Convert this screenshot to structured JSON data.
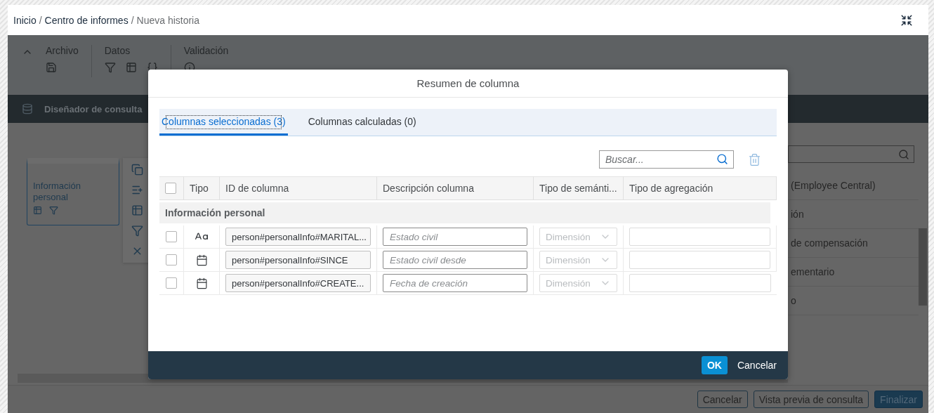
{
  "header": {
    "breadcrumb": [
      {
        "label": "Inicio",
        "current": false
      },
      {
        "separator": "/",
        "label": "Centro de informes",
        "current": false
      },
      {
        "separator": "/",
        "label": "Nueva historia",
        "current": true
      }
    ]
  },
  "toolbar": {
    "groups": [
      {
        "label": "Archivo",
        "kind": "file"
      },
      {
        "label": "Datos",
        "kind": "data"
      },
      {
        "label": "Validación",
        "kind": "validation"
      }
    ]
  },
  "designer_bar": {
    "title": "Diseñador de consulta"
  },
  "canvas": {
    "node": {
      "title": "Información personal"
    }
  },
  "side_panel": {
    "items": [
      "(Employee Central)",
      "ión",
      "de compensación",
      "ementario",
      "o"
    ]
  },
  "footer_buttons": [
    {
      "label": "Cancelar",
      "kind": "secondary"
    },
    {
      "label": "Vista previa de consulta",
      "kind": "secondary"
    },
    {
      "label": "Finalizar",
      "kind": "primary"
    }
  ],
  "dialog": {
    "title": "Resumen de columna",
    "tabs": [
      {
        "label": "Columnas seleccionadas (3)",
        "selected": true
      },
      {
        "label": "Columnas calculadas (0)",
        "selected": false
      }
    ],
    "search": {
      "placeholder": "Buscar..."
    },
    "table": {
      "all_checked": false,
      "columns": [
        "Tipo",
        "ID de columna",
        "Descripción columna",
        "Tipo de semánti...",
        "Tipo de agregación"
      ],
      "groups": [
        {
          "title": "Información personal",
          "rows": [
            {
              "checked": false,
              "kind": "text",
              "column_id": "person#personalInfo#MARITAL...",
              "description_placeholder": "Estado civil",
              "semantic": {
                "value": "Dimensión",
                "disabled": true
              }
            },
            {
              "checked": false,
              "kind": "date",
              "column_id": "person#personalInfo#SINCE",
              "description_placeholder": "Estado civil desde",
              "semantic": {
                "value": "Dimensión",
                "disabled": true
              }
            },
            {
              "checked": false,
              "kind": "date",
              "column_id": "person#personalInfo#CREATE...",
              "description_placeholder": "Fecha de creación",
              "semantic": {
                "value": "Dimensión",
                "disabled": true
              }
            }
          ]
        }
      ]
    },
    "buttons": [
      {
        "label": "OK",
        "kind": "emphasized"
      },
      {
        "label": "Cancelar",
        "kind": "transparent"
      }
    ]
  }
}
